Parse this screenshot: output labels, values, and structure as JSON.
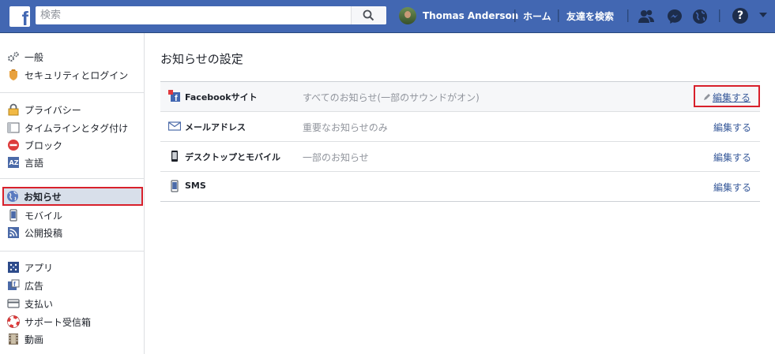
{
  "topbar": {
    "logo": "f",
    "search_placeholder": "検索",
    "user_name": "Thomas Anderson",
    "home": "ホーム",
    "find_friends": "友達を検索",
    "help": "?",
    "icons": [
      "friends-icon",
      "messenger-icon",
      "globe-icon",
      "help-icon",
      "caret-down-icon"
    ]
  },
  "sidebar": {
    "items": [
      {
        "label": "一般"
      },
      {
        "label": "セキュリティとログイン"
      },
      {
        "label": "プライバシー"
      },
      {
        "label": "タイムラインとタグ付け"
      },
      {
        "label": "ブロック"
      },
      {
        "label": "言語"
      },
      {
        "label": "お知らせ",
        "active": true
      },
      {
        "label": "モバイル"
      },
      {
        "label": "公開投稿"
      },
      {
        "label": "アプリ"
      },
      {
        "label": "広告"
      },
      {
        "label": "支払い"
      },
      {
        "label": "サポート受信箱"
      },
      {
        "label": "動画"
      }
    ]
  },
  "main": {
    "title": "お知らせの設定",
    "rows": [
      {
        "label": "Facebookサイト",
        "value": "すべてのお知らせ(一部のサウンドがオン)",
        "action": "編集する"
      },
      {
        "label": "メールアドレス",
        "value": "重要なお知らせのみ",
        "action": "編集する"
      },
      {
        "label": "デスクトップとモバイル",
        "value": "一部のお知らせ",
        "action": "編集する"
      },
      {
        "label": "SMS",
        "value": "",
        "action": "編集する"
      }
    ]
  },
  "colors": {
    "brand": "#4267b2",
    "link": "#365899",
    "highlight": "#d8202b",
    "active_bg": "#d8dfea"
  }
}
